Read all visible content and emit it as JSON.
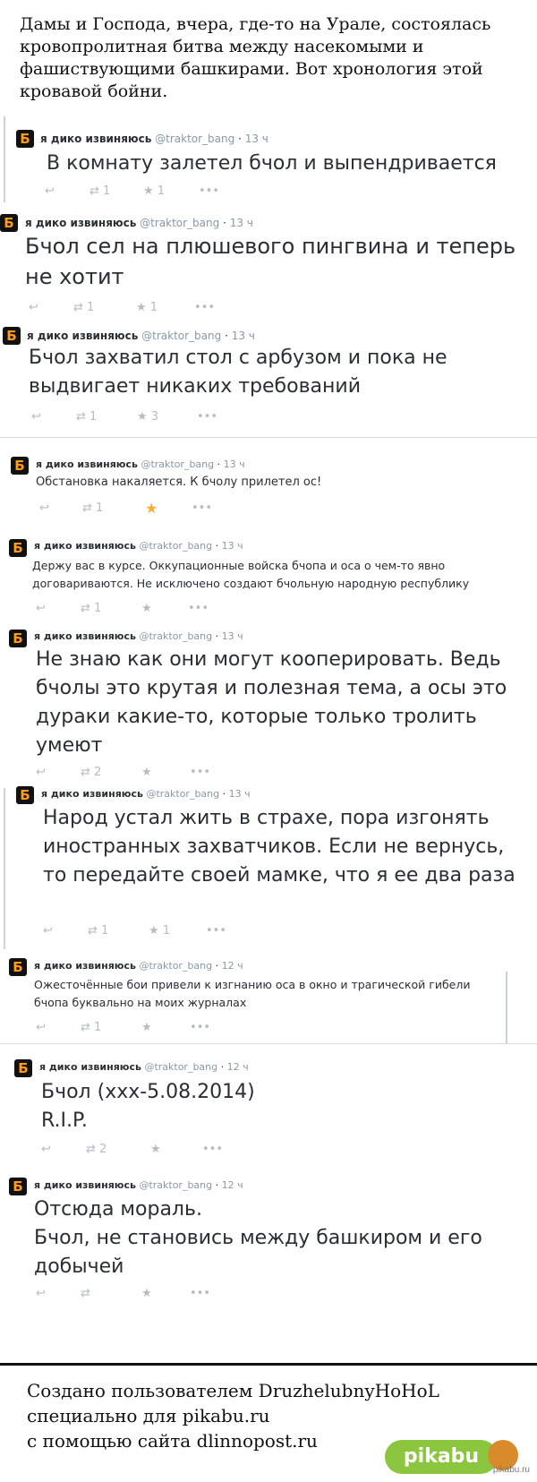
{
  "intro": "Дамы и Господа, вчера, где-то на Урале, состоялась кровопролитная битва между насекомыми и фашиствующими башкирами. Вот хронология этой кровавой бойни.",
  "author": {
    "name": "я дико извиняюсь",
    "handle": "@traktor_bang"
  },
  "tweets": [
    {
      "time": "13 ч",
      "text": "В комнату залетел бчол и выпендривается",
      "retweets": "1",
      "favorites": "1"
    },
    {
      "time": "13 ч",
      "text": "Бчол сел на плюшевого пингвина и теперь не хотит",
      "retweets": "1",
      "favorites": "1"
    },
    {
      "time": "13 ч",
      "text": "Бчол захватил стол с арбузом и пока не выдвигает никаких требований",
      "retweets": "1",
      "favorites": "3"
    },
    {
      "time": "13 ч",
      "text": "Обстановка накаляется. К бчолу прилетел ос!",
      "retweets": "1",
      "favorites": ""
    },
    {
      "time": "13 ч",
      "text": "Держу вас в курсе. Оккупационные войска бчопа и оса о чем-то явно договариваются. Не исключено создают бчольную народную республику",
      "retweets": "1",
      "favorites": ""
    },
    {
      "time": "13 ч",
      "text": "Не знаю как они могут кооперировать. Ведь бчолы это крутая и полезная тема, а осы это дураки какие-то, которые только тролить умеют",
      "retweets": "2",
      "favorites": ""
    },
    {
      "time": "13 ч",
      "text": "Народ устал жить в страхе, пора изгонять иностранных захватчиков. Если не вернусь, то передайте своей мамке, что я ее два раза",
      "retweets": "1",
      "favorites": "1"
    },
    {
      "time": "12 ч",
      "text": "Ожесточённые бои привели к изгнанию оса в окно и трагической гибели бчопа буквально на моих журналах",
      "retweets": "1",
      "favorites": ""
    },
    {
      "time": "12 ч",
      "text": "Бчол (ххх-5.08.2014)\nR.I.P.",
      "retweets": "2",
      "favorites": ""
    },
    {
      "time": "12 ч",
      "text": "Отсюда мораль.\nБчол, не становись между башкиром и его добычей",
      "retweets": "",
      "favorites": ""
    }
  ],
  "footer": {
    "line1": "Создано пользователем DruzhelubnyHoHoL",
    "line2": "специально для pikabu.ru",
    "line3": "с помощью сайта dlinnopost.ru",
    "logo": "pikabu",
    "watermark": "pikabu.ru"
  },
  "colors": {
    "star_active": "#ffac33",
    "icon": "#b5bcc3",
    "logo_bg": "#111111",
    "logo_fg": "#ff9a1a"
  }
}
